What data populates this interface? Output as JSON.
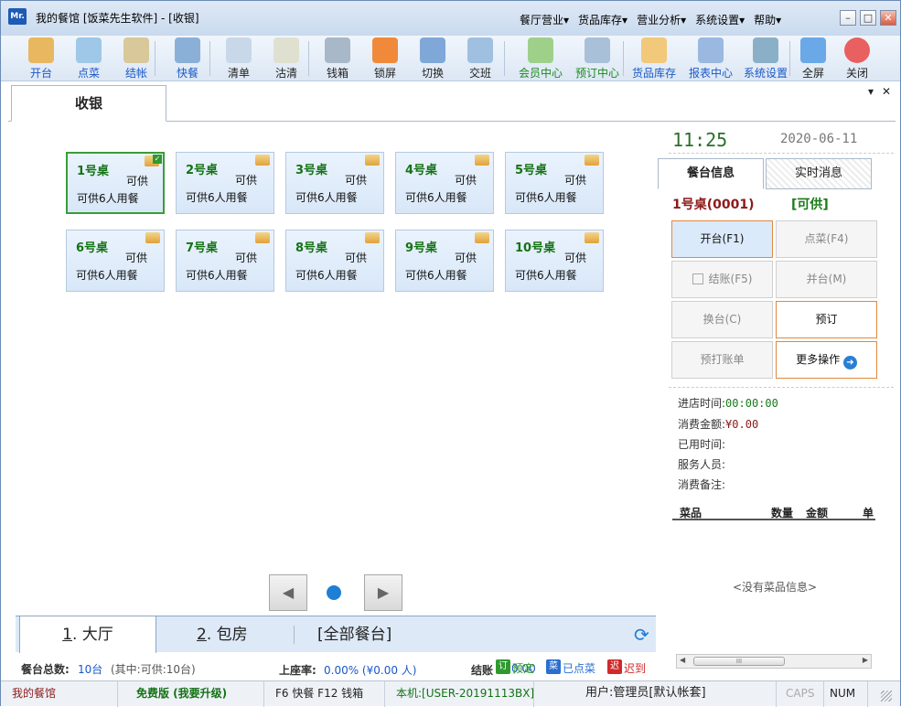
{
  "window": {
    "title": "我的餐馆 [饭菜先生软件] - [收银]",
    "app_icon": "Mr.",
    "menus": [
      "餐厅营业▾",
      "货品库存▾",
      "营业分析▾",
      "系统设置▾",
      "帮助▾"
    ],
    "controls": {
      "min": "–",
      "max": "□",
      "close": "✕"
    }
  },
  "toolbar": [
    {
      "label": "开台",
      "icon": "open-table-icon",
      "color": "blue"
    },
    {
      "label": "点菜",
      "icon": "order-dish-icon",
      "color": "blue"
    },
    {
      "label": "结帐",
      "icon": "checkout-icon",
      "color": "blue"
    },
    {
      "label": "快餐",
      "icon": "fast-food-clock-icon",
      "color": "blue"
    },
    {
      "label": "清单",
      "icon": "list-icon",
      "color": "black"
    },
    {
      "label": "沽清",
      "icon": "sold-out-icon",
      "color": "black"
    },
    {
      "label": "钱箱",
      "icon": "cash-box-icon",
      "color": "black"
    },
    {
      "label": "锁屏",
      "icon": "lock-icon",
      "color": "black"
    },
    {
      "label": "切换",
      "icon": "switch-user-icon",
      "color": "black"
    },
    {
      "label": "交班",
      "icon": "shift-change-icon",
      "color": "black"
    },
    {
      "label": "会员中心",
      "icon": "member-center-icon",
      "color": "green"
    },
    {
      "label": "预订中心",
      "icon": "reservation-center-icon",
      "color": "green"
    },
    {
      "label": "货品库存",
      "icon": "inventory-icon",
      "color": "blue"
    },
    {
      "label": "报表中心",
      "icon": "report-chart-icon",
      "color": "blue"
    },
    {
      "label": "系统设置",
      "icon": "system-settings-icon",
      "color": "blue"
    },
    {
      "label": "全屏",
      "icon": "fullscreen-icon",
      "color": "black"
    },
    {
      "label": "关闭",
      "icon": "power-icon",
      "color": "black"
    }
  ],
  "doc_tab": {
    "label": "收银",
    "ctrl_menu": "▾",
    "ctrl_close": "✕"
  },
  "tables": [
    {
      "name": "1号桌",
      "status": "可供",
      "capacity": "可供6人用餐",
      "selected": true
    },
    {
      "name": "2号桌",
      "status": "可供",
      "capacity": "可供6人用餐"
    },
    {
      "name": "3号桌",
      "status": "可供",
      "capacity": "可供6人用餐"
    },
    {
      "name": "4号桌",
      "status": "可供",
      "capacity": "可供6人用餐"
    },
    {
      "name": "5号桌",
      "status": "可供",
      "capacity": "可供6人用餐"
    },
    {
      "name": "6号桌",
      "status": "可供",
      "capacity": "可供6人用餐"
    },
    {
      "name": "7号桌",
      "status": "可供",
      "capacity": "可供6人用餐"
    },
    {
      "name": "8号桌",
      "status": "可供",
      "capacity": "可供6人用餐"
    },
    {
      "name": "9号桌",
      "status": "可供",
      "capacity": "可供6人用餐"
    },
    {
      "name": "10号桌",
      "status": "可供",
      "capacity": "可供6人用餐"
    }
  ],
  "pager": {
    "prev": "◀",
    "next": "▶"
  },
  "area_tabs": {
    "hall": {
      "num": "1",
      "label": ". 大厅"
    },
    "room": {
      "num": "2",
      "label": ". 包房"
    },
    "all": "[全部餐台]"
  },
  "summary": {
    "total_label": "餐台总数:",
    "total_value": "10台",
    "total_detail": "(其中:可供:10台)",
    "occupancy_label": "上座率:",
    "occupancy_value": "0.00% (¥0.00 人)",
    "checkout_label": "结账",
    "checkout_value": "0.00",
    "legend_reserved": "预定",
    "legend_ordered": "已点菜",
    "legend_late": "迟到",
    "badge_reserved": "订",
    "badge_ordered": "菜",
    "badge_late": "迟"
  },
  "side": {
    "time": "11:25",
    "date": "2020-06-11",
    "tab_info": "餐台信息",
    "tab_msg": "实时消息",
    "current_table": "1号桌(0001)",
    "current_status": "[可供]",
    "actions": {
      "open": "开台(F1)",
      "order": "点菜(F4)",
      "checkout": "结账(F5)",
      "merge": "并台(M)",
      "change": "换台(C)",
      "reserve": "预订",
      "preprint": "预打账单",
      "more": "更多操作"
    },
    "info": {
      "enter_time_label": "进店时间:",
      "enter_time_value": "00:00:00",
      "amount_label": "消费金额:",
      "amount_value": "¥0.00",
      "used_time_label": "已用时间:",
      "waiter_label": "服务人员:",
      "remark_label": "消费备注:"
    },
    "dish_cols": [
      "菜品",
      "数量",
      "金额",
      "单"
    ],
    "no_dish": "<没有菜品信息>",
    "scroll_thumb": "III"
  },
  "statusbar": {
    "shop": "我的餐馆",
    "edition": "免费版 (我要升级)",
    "hotkeys": "F6 快餐 F12 钱箱",
    "host": "本机:[USER-20191113BX]",
    "user": "用户:管理员[默认帐套]",
    "caps": "CAPS",
    "num": "NUM"
  },
  "colors": {
    "accent_green": "#147214",
    "accent_blue": "#1a58c8",
    "accent_red": "#8b1a1a",
    "highlight_orange": "#e0883c"
  }
}
